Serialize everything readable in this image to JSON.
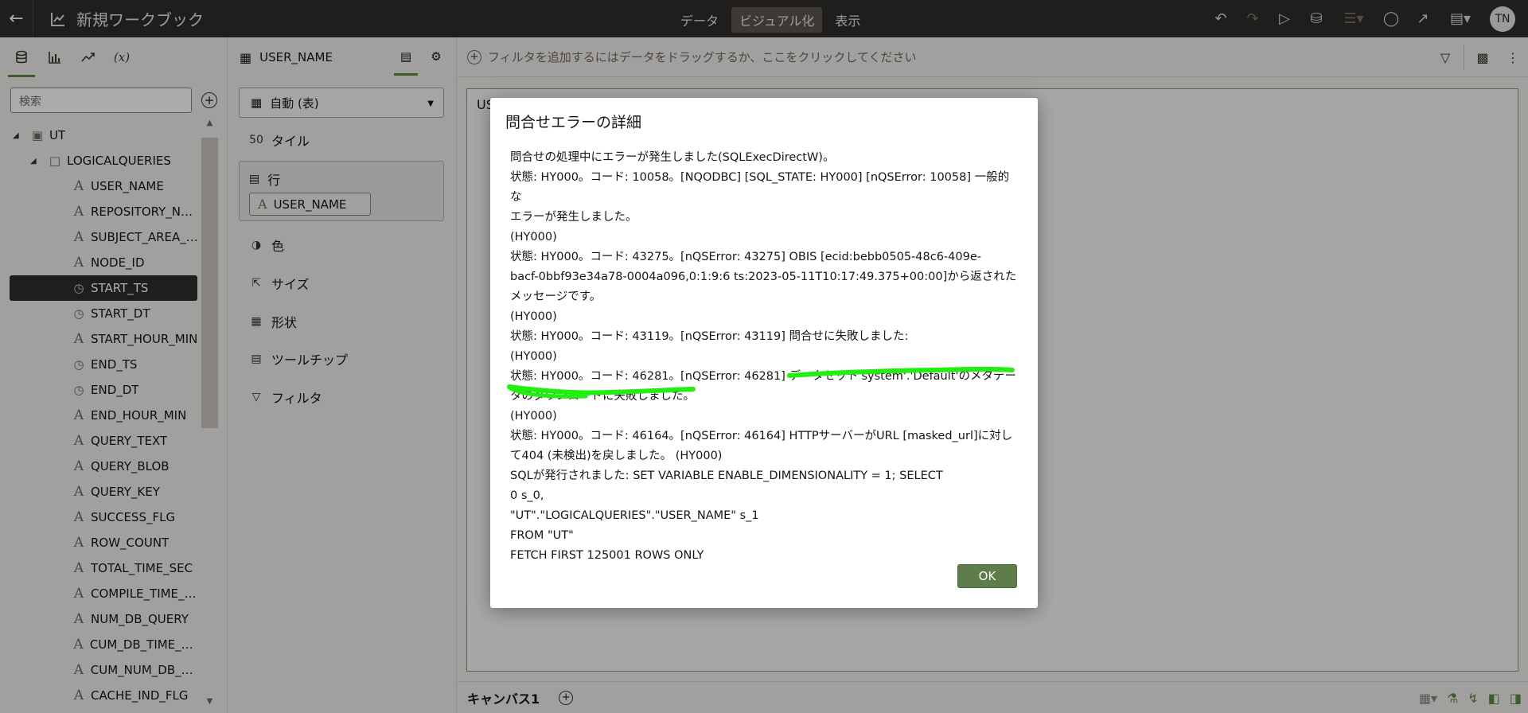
{
  "header": {
    "title": "新規ワークブック",
    "modes": [
      "データ",
      "ビジュアル化",
      "表示"
    ],
    "active_mode": "ビジュアル化",
    "avatar_initials": "TN"
  },
  "data_panel": {
    "search_placeholder": "検索",
    "tabs": [
      "data-tab",
      "viz-tab",
      "analytics-tab",
      "calc-tab"
    ],
    "calc_tab_label": "(x)",
    "tree": {
      "root": "UT",
      "folder": "LOGICALQUERIES",
      "columns": [
        {
          "label": "USER_NAME",
          "type": "text"
        },
        {
          "label": "REPOSITORY_NA…",
          "type": "text"
        },
        {
          "label": "SUBJECT_AREA_…",
          "type": "text"
        },
        {
          "label": "NODE_ID",
          "type": "text"
        },
        {
          "label": "START_TS",
          "type": "time",
          "selected": true
        },
        {
          "label": "START_DT",
          "type": "time"
        },
        {
          "label": "START_HOUR_MIN",
          "type": "text"
        },
        {
          "label": "END_TS",
          "type": "time"
        },
        {
          "label": "END_DT",
          "type": "time"
        },
        {
          "label": "END_HOUR_MIN",
          "type": "text"
        },
        {
          "label": "QUERY_TEXT",
          "type": "text"
        },
        {
          "label": "QUERY_BLOB",
          "type": "text"
        },
        {
          "label": "QUERY_KEY",
          "type": "text"
        },
        {
          "label": "SUCCESS_FLG",
          "type": "text"
        },
        {
          "label": "ROW_COUNT",
          "type": "text"
        },
        {
          "label": "TOTAL_TIME_SEC",
          "type": "text"
        },
        {
          "label": "COMPILE_TIME_…",
          "type": "text"
        },
        {
          "label": "NUM_DB_QUERY",
          "type": "text"
        },
        {
          "label": "CUM_DB_TIME_SEC",
          "type": "text"
        },
        {
          "label": "CUM_NUM_DB_R…",
          "type": "text"
        },
        {
          "label": "CACHE_IND_FLG",
          "type": "text"
        }
      ]
    }
  },
  "grammar_panel": {
    "dataset_name": "USER_NAME",
    "viz_type": "自動 (表)",
    "tile_label": "タイル",
    "tile_icon_text": "50",
    "rows_label": "行",
    "rows_pill": "USER_NAME",
    "color_label": "色",
    "size_label": "サイズ",
    "shape_label": "形状",
    "tooltip_label": "ツールチップ",
    "filter_label": "フィルタ"
  },
  "filter_bar": {
    "placeholder": "フィルタを追加するにはデータをドラッグするか、ここをクリックしてください"
  },
  "canvas": {
    "viz_title_partial": "US",
    "tab_label": "キャンバス1"
  },
  "dialog": {
    "title": "問合せエラーの詳細",
    "lines": [
      "問合せの処理中にエラーが発生しました(SQLExecDirectW)。",
      "状態: HY000。コード: 10058。[NQODBC] [SQL_STATE: HY000] [nQSError: 10058] 一般的な",
      "エラーが発生しました。",
      "(HY000)",
      "状態: HY000。コード: 43275。[nQSError: 43275] OBIS [ecid:bebb0505-48c6-409e-",
      "bacf-0bbf93e34a78-0004a096,0:1:9:6 ts:2023-05-11T10:17:49.375+00:00]から返された",
      "メッセージです。",
      "(HY000)",
      "状態: HY000。コード: 43119。[nQSError: 43119] 問合せに失敗しました:",
      "(HY000)",
      "状態: HY000。コード: 46281。[nQSError: 46281] データセット'system'.'Default'のメタデー",
      "タのダウンロードに失敗しました。",
      "(HY000)",
      "状態: HY000。コード: 46164。[nQSError: 46164] HTTPサーバーがURL [masked_url]に対し",
      "て404 (未検出)を戻しました。 (HY000)",
      "SQLが発行されました: SET VARIABLE ENABLE_DIMENSIONALITY = 1; SELECT",
      "0 s_0,",
      "\"UT\".\"LOGICALQUERIES\".\"USER_NAME\" s_1",
      "FROM \"UT\"",
      "FETCH FIRST 125001 ROWS ONLY"
    ],
    "ok_label": "OK",
    "highlight_color": "#22ee11"
  }
}
